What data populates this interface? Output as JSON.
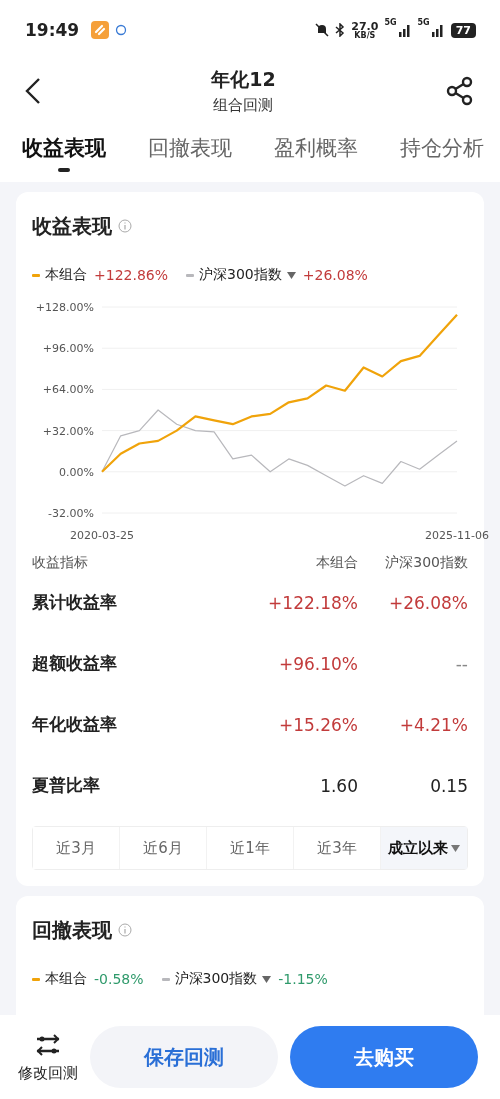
{
  "status_bar": {
    "time": "19:49",
    "net_speed": "27.0",
    "net_unit": "KB/S",
    "signal_1": "5G",
    "signal_2": "5G",
    "battery": "77"
  },
  "header": {
    "title": "年化12",
    "subtitle": "组合回测"
  },
  "tabs": [
    {
      "label": "收益表现",
      "selected": true
    },
    {
      "label": "回撤表现",
      "selected": false
    },
    {
      "label": "盈利概率",
      "selected": false
    },
    {
      "label": "持仓分析",
      "selected": false
    }
  ],
  "returns_card": {
    "title": "收益表现",
    "legend": [
      {
        "value": {
          "text": "+122.86%",
          "color": "#c23b3b"
        },
        "dropdown": false
      },
      {
        "value": {
          "text": "+26.08%",
          "color": "#c23b3b"
        },
        "dropdown": true
      }
    ],
    "chart_data": {
      "type": "line",
      "grid": true,
      "categories": [
        "2020-03-25",
        null,
        null,
        null,
        null,
        null,
        null,
        null,
        null,
        null,
        null,
        null,
        null,
        null,
        null,
        null,
        null,
        null,
        null,
        "2025-11-06"
      ],
      "yticks": [
        {
          "value": 128,
          "label": "+128.00%"
        },
        {
          "value": 96,
          "label": "+96.00%"
        },
        {
          "value": 64,
          "label": "+64.00%"
        },
        {
          "value": 32,
          "label": "+32.00%"
        },
        {
          "value": 0,
          "label": "0.00%"
        },
        {
          "value": -32,
          "label": "-32.00%"
        }
      ],
      "ylim": [
        -32,
        128
      ],
      "series": [
        {
          "name": "本组合",
          "color": "#f0a30a",
          "values": [
            0,
            14,
            22,
            24,
            32,
            43,
            40,
            37,
            43,
            45,
            54,
            57,
            67,
            63,
            81,
            74,
            86,
            90,
            106,
            122
          ]
        },
        {
          "name": "沪深300指数",
          "color": "#b8b8bc",
          "values": [
            0,
            28,
            32,
            48,
            37,
            32,
            31,
            10,
            13,
            0,
            10,
            5,
            -3,
            -11,
            -3,
            -9,
            8,
            2,
            13,
            24
          ]
        }
      ]
    },
    "metrics_header": [
      "收益指标",
      "本组合",
      "沪深300指数"
    ],
    "metrics": [
      {
        "name": "累计收益率",
        "portfolio": {
          "text": "+122.18%",
          "color": "#c23b3b"
        },
        "index": {
          "text": "+26.08%",
          "color": "#c23b3b"
        }
      },
      {
        "name": "超额收益率",
        "portfolio": {
          "text": "+96.10%",
          "color": "#c23b3b"
        },
        "index": {
          "text": "--",
          "color": "#888888"
        }
      },
      {
        "name": "年化收益率",
        "portfolio": {
          "text": "+15.26%",
          "color": "#c23b3b"
        },
        "index": {
          "text": "+4.21%",
          "color": "#c23b3b"
        }
      },
      {
        "name": "夏普比率",
        "portfolio": {
          "text": "1.60",
          "color": "#222222"
        },
        "index": {
          "text": "0.15",
          "color": "#222222"
        }
      }
    ],
    "periods": [
      {
        "label": "近3月",
        "selected": false,
        "dropdown": false
      },
      {
        "label": "近6月",
        "selected": false,
        "dropdown": false
      },
      {
        "label": "近1年",
        "selected": false,
        "dropdown": false
      },
      {
        "label": "近3年",
        "selected": false,
        "dropdown": false
      },
      {
        "label": "成立以来",
        "selected": true,
        "dropdown": true
      }
    ]
  },
  "drawdown_card": {
    "title": "回撤表现",
    "legend": [
      {
        "name": "本组合",
        "value": {
          "text": "-0.58%",
          "color": "#2f9a6b"
        },
        "color": "#f0a30a",
        "dropdown": false
      },
      {
        "name": "沪深300指数",
        "value": {
          "text": "-1.15%",
          "color": "#2f9a6b"
        },
        "color": "#b8b8bc",
        "dropdown": true
      }
    ]
  },
  "bottom_bar": {
    "edit_label": "修改回测",
    "save_button": "保存回测",
    "buy_button": "去购买"
  }
}
